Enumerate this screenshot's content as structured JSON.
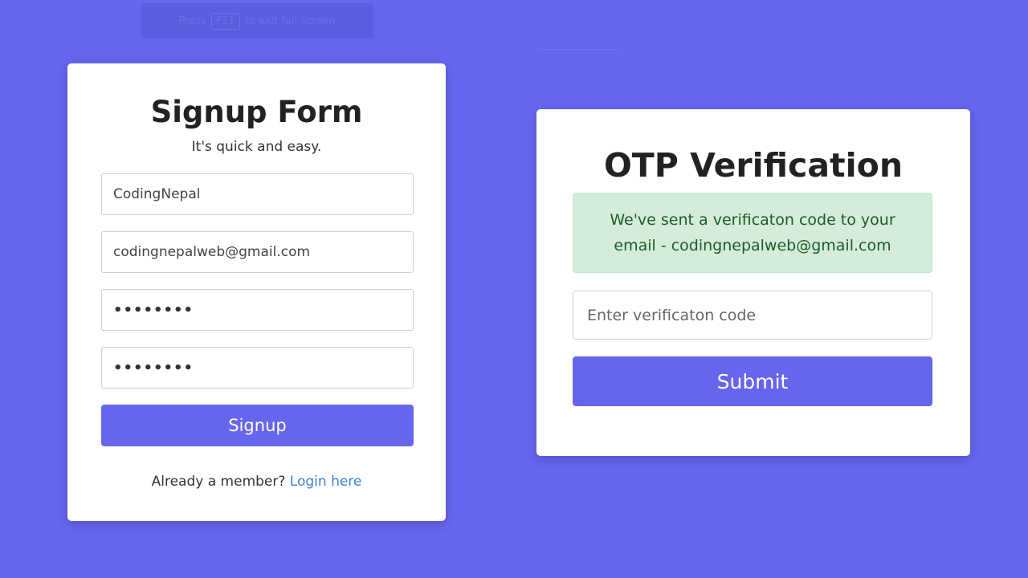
{
  "overlay": {
    "press": "Press",
    "key": "F11",
    "hint": "to exit full screen"
  },
  "signup": {
    "title": "Signup Form",
    "subtitle": "It's quick and easy.",
    "name_value": "CodingNepal",
    "email_value": "codingnepalweb@gmail.com",
    "password_value": "••••••••",
    "confirm_password_value": "••••••••",
    "signup_button": "Signup",
    "already_member": "Already a member?",
    "login_link": "Login here"
  },
  "otp": {
    "title": "OTP Verification",
    "alert_text": "We've sent a verificaton code to your email - codingnepalweb@gmail.com",
    "code_placeholder": "Enter verificaton code",
    "submit_button": "Submit"
  },
  "colors": {
    "background": "#6665ee",
    "button": "#6665ee",
    "alert_bg": "#d4ecd9",
    "alert_text": "#1e5b2b",
    "link": "#3b82d6"
  }
}
